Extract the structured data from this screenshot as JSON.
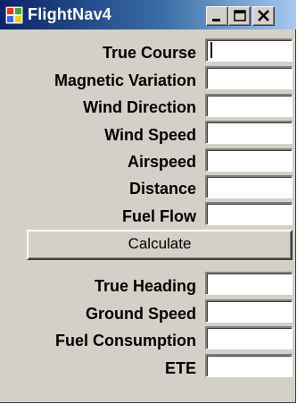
{
  "window": {
    "title": "FlightNav4",
    "controls": {
      "minimize_icon": "minimize-icon",
      "maximize_icon": "maximize-icon",
      "close_icon": "close-icon"
    },
    "title_gradient": [
      "#0a246a",
      "#a6caf0"
    ],
    "face_color": "#d4d0c8"
  },
  "inputs": [
    {
      "label": "True Course",
      "value": ""
    },
    {
      "label": "Magnetic Variation",
      "value": ""
    },
    {
      "label": "Wind Direction",
      "value": ""
    },
    {
      "label": "Wind Speed",
      "value": ""
    },
    {
      "label": "Airspeed",
      "value": ""
    },
    {
      "label": "Distance",
      "value": ""
    },
    {
      "label": "Fuel Flow",
      "value": ""
    }
  ],
  "calculate_button": {
    "label": "Calculate"
  },
  "outputs": [
    {
      "label": "True Heading",
      "value": ""
    },
    {
      "label": "Ground Speed",
      "value": ""
    },
    {
      "label": "Fuel Consumption",
      "value": ""
    },
    {
      "label": "ETE",
      "value": ""
    }
  ]
}
